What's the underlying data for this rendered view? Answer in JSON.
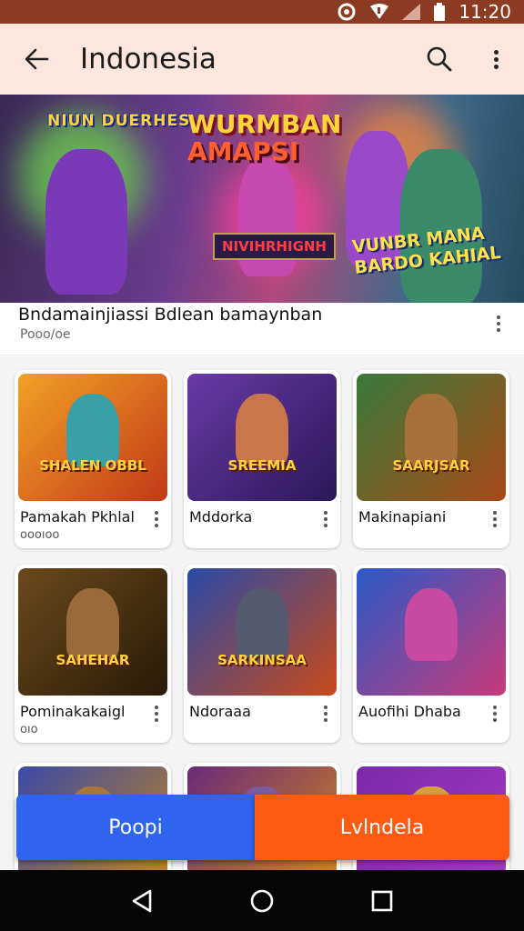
{
  "status_bar": {
    "time": "11:20"
  },
  "app_bar": {
    "title": "Indonesia"
  },
  "banner": {
    "text_left": "NIUN DUERHES",
    "text_main_1": "WURMBAN",
    "text_main_2": "AMAPSI",
    "text_plate": "NIVIHRHIGNH",
    "text_right": "VUNBR MANA BARDO KAHIAL"
  },
  "featured": {
    "title": "Bndamainjiassi Bdlean bamaynban",
    "subtitle": "Pooo/oe"
  },
  "cards": [
    {
      "label": "Pamakah Pkhlal",
      "sub": "oooıoo",
      "badge": "SHALEN OBBL",
      "colors": [
        "#f3a024",
        "#c23a18"
      ],
      "hero": "#3aa0a8"
    },
    {
      "label": "Mddorka",
      "sub": "",
      "badge": "SREEMIA",
      "colors": [
        "#6a3aa8",
        "#2a1858"
      ],
      "hero": "#c8764a"
    },
    {
      "label": "Makinapiani",
      "sub": "",
      "badge": "SAARJSAR",
      "colors": [
        "#3a7a3a",
        "#a84a18"
      ],
      "hero": "#a8703a"
    },
    {
      "label": "Pominakakaigl",
      "sub": "oıo",
      "badge": "SAHEHAR",
      "colors": [
        "#6a4a1a",
        "#2a1a08"
      ],
      "hero": "#9a6a3a"
    },
    {
      "label": "Ndoraaa",
      "sub": "",
      "badge": "SARKINSAA",
      "colors": [
        "#2a4aa8",
        "#c84a1a"
      ],
      "hero": "#555a70"
    },
    {
      "label": "Auofihi Dhaba",
      "sub": "",
      "badge": "",
      "colors": [
        "#2a5ac8",
        "#c83a7a"
      ],
      "hero": "#c84aa0"
    },
    {
      "label": "",
      "sub": "",
      "badge": "",
      "colors": [
        "#3a4aa8",
        "#c8881a"
      ],
      "hero": "#a8783a"
    },
    {
      "label": "",
      "sub": "",
      "badge": "",
      "colors": [
        "#6a2a7a",
        "#d88a1a"
      ],
      "hero": "#7a5aa0"
    },
    {
      "label": "",
      "sub": "",
      "badge": "",
      "colors": [
        "#7a2aa8",
        "#a83ac8"
      ],
      "hero": "#d8a03a"
    }
  ],
  "buttons": {
    "primary": "Poopi",
    "secondary": "Lvlndela"
  },
  "colors": {
    "status_bar": "#8c3a22",
    "app_bar": "#fde6dc",
    "button_blue": "#2f64f0",
    "button_orange": "#ff5a12"
  }
}
